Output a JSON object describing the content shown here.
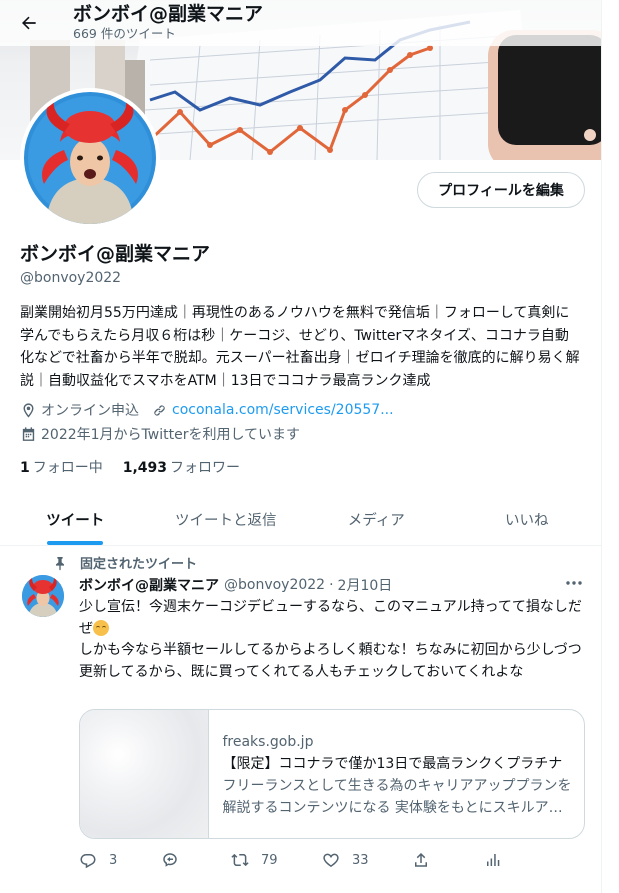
{
  "header": {
    "title": "ボンボイ@副業マニア",
    "tweet_count": "669 件のツイート"
  },
  "profile": {
    "edit_button": "プロフィールを編集",
    "name": "ボンボイ@副業マニア",
    "handle": "@bonvoy2022",
    "bio": "副業開始初月55万円達成｜再現性のあるノウハウを無料で発信垢｜フォローして真剣に学んでもらえたら月収６桁は秒｜ケーコジ、せどり、Twitterマネタイズ、ココナラ自動化などで社畜から半年で脱却。元スーパー社畜出身｜ゼロイチ理論を徹底的に解り易く解説｜自動収益化でスマホをATM｜13日でココナラ最高ランク達成",
    "location": "オンライン申込",
    "url": "coconala.com/services/20557...",
    "joined": "2022年1月からTwitterを利用しています",
    "following_count": "1",
    "following_label": "フォロー中",
    "followers_count": "1,493",
    "followers_label": "フォロワー"
  },
  "tabs": [
    {
      "label": "ツイート",
      "active": true
    },
    {
      "label": "ツイートと返信",
      "active": false
    },
    {
      "label": "メディア",
      "active": false
    },
    {
      "label": "いいね",
      "active": false
    }
  ],
  "tweet": {
    "pinned_label": "固定されたツイート",
    "name": "ボンボイ@副業マニア",
    "handle": "@bonvoy2022",
    "separator": "·",
    "date": "2月10日",
    "text_line1": "少し宣伝！今週末ケーコジデビューするなら、このマニュアル持ってて損なしだぜ",
    "text_rest": "しかも今なら半額セールしてるからよろしく頼むな！ちなみに初回から少しづつ更新してるから、既に買ってくれてる人もチェックしておいてくれよな",
    "card": {
      "domain": "freaks.gob.jp",
      "title": "【限定】ココナラで僅か13日で最高ランクくプラチナ",
      "description": "フリーランスとして生きる為のキャリアアッププランを解説するコンテンツになる 実体験をもとにスキルアップする方法"
    },
    "replies": "3",
    "retweets": "79",
    "likes": "33"
  },
  "colors": {
    "accent": "#1d9bf0",
    "secondary_text": "#536471",
    "border": "#cfd9de"
  },
  "icons": [
    "back-arrow-icon",
    "location-icon",
    "link-icon",
    "calendar-icon",
    "pin-icon",
    "more-icon",
    "reply-icon",
    "share-to-icon",
    "retweet-icon",
    "like-icon",
    "upload-icon",
    "analytics-icon"
  ]
}
